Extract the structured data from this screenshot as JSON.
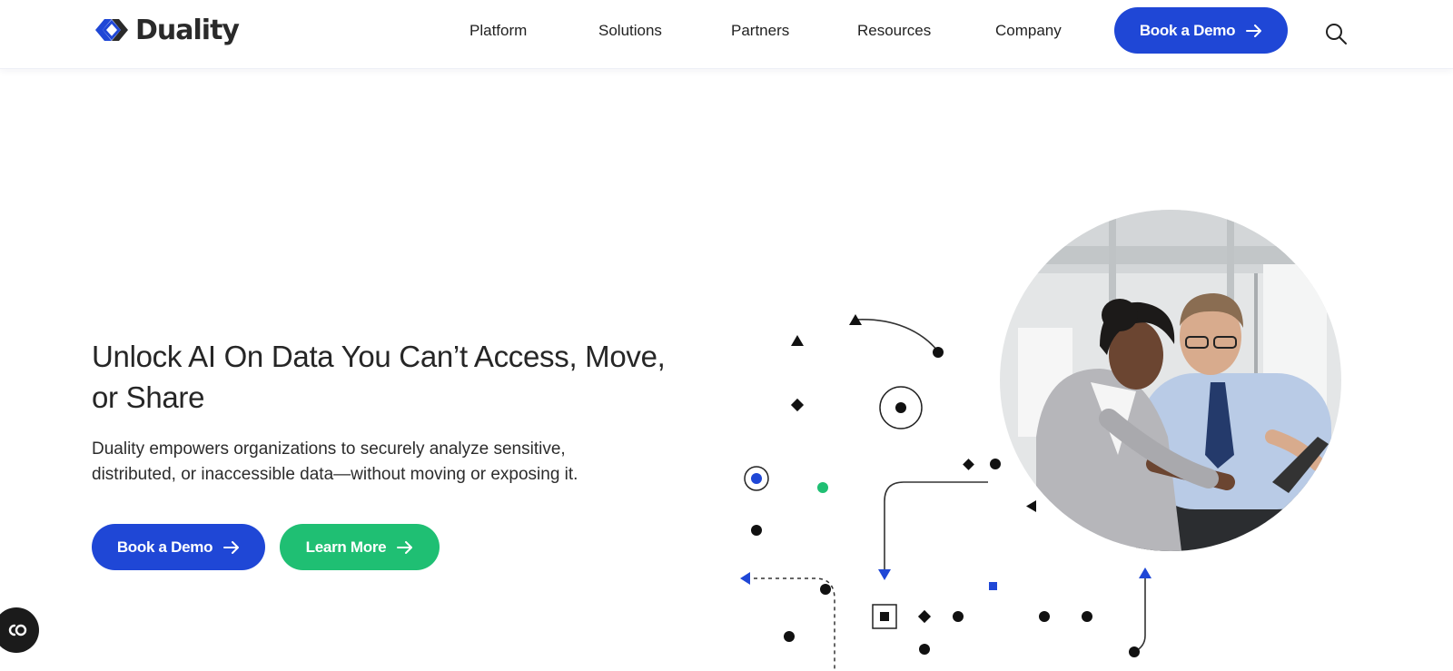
{
  "brand": {
    "name": "Duality",
    "accent": "#1f47d6",
    "green": "#1fbf73"
  },
  "nav": {
    "items": [
      {
        "label": "Platform"
      },
      {
        "label": "Solutions"
      },
      {
        "label": "Partners"
      },
      {
        "label": "Resources"
      },
      {
        "label": "Company"
      }
    ],
    "cta_label": "Book a Demo",
    "search_icon": "search-icon"
  },
  "hero": {
    "title": "Unlock AI On Data You Can’t Access, Move, or Share",
    "subtitle": "Duality empowers organizations to securely analyze sensitive, distributed, or inaccessible data—without moving or exposing it.",
    "primary_label": "Book a Demo",
    "secondary_label": "Learn More",
    "arrow_icon": "arrow-right-icon"
  },
  "widget": {
    "icon": "chat-icon"
  }
}
